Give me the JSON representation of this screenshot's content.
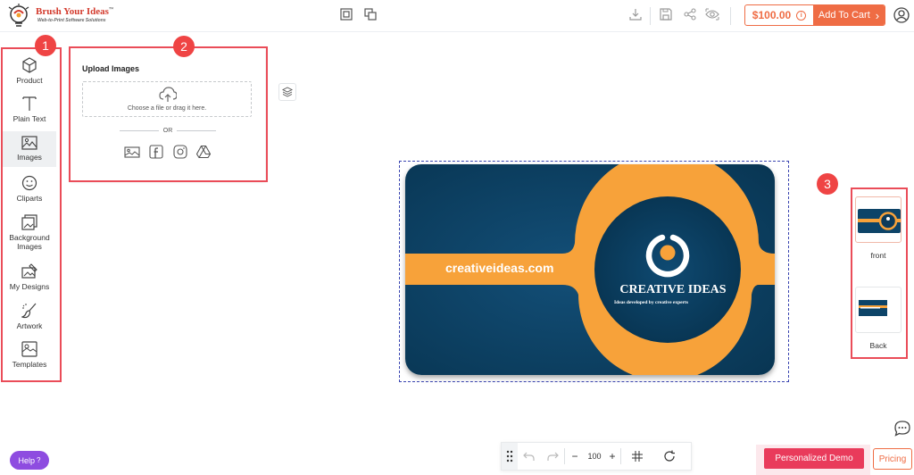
{
  "brand": {
    "name": "Brush Your Ideas",
    "trademark": "™",
    "tagline": "Web-to-Print Software Solutions"
  },
  "header": {
    "price": "$100.00",
    "price_info_glyph": "i",
    "add_to_cart": "Add To Cart",
    "cart_arrow": "›"
  },
  "sidebar": {
    "items": [
      {
        "label": "Product",
        "icon": "cube-icon"
      },
      {
        "label": "Plain Text",
        "icon": "text-icon"
      },
      {
        "label": "Images",
        "icon": "image-icon"
      },
      {
        "label": "Cliparts",
        "icon": "smiley-icon"
      },
      {
        "label": "Background",
        "label2": "Images",
        "icon": "background-icon"
      },
      {
        "label": "My Designs",
        "icon": "my-designs-icon"
      },
      {
        "label": "Artwork",
        "icon": "brush-icon"
      },
      {
        "label": "Templates",
        "icon": "templates-icon"
      }
    ],
    "active": "Images"
  },
  "upload_panel": {
    "title": "Upload Images",
    "dropzone_text": "Choose a file or drag it here.",
    "or_text": "OR"
  },
  "badges": {
    "one": "1",
    "two": "2",
    "three": "3"
  },
  "card": {
    "website": "creativeideas.com",
    "company": "CREATIVE IDEAS",
    "tagline": "Ideas developed by creative experts"
  },
  "sides": [
    {
      "label": "front"
    },
    {
      "label": "Back"
    }
  ],
  "toolbar": {
    "zoom": "100",
    "minus": "−",
    "plus": "+"
  },
  "footer": {
    "help": "Help",
    "help_glyph": "?",
    "demo": "Personalized Demo",
    "pricing": "Pricing"
  },
  "colors": {
    "accent": "#ef6c44",
    "annotation": "#ea4c58",
    "card_bg": "#0d4468",
    "card_orange": "#f7a23a",
    "demo": "#e93b5b",
    "help": "#8e4ce0"
  }
}
